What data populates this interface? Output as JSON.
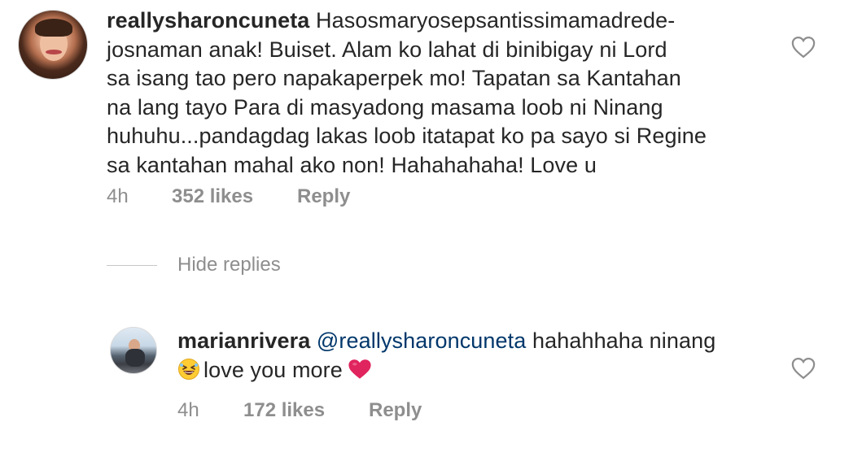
{
  "main_comment": {
    "username": "reallysharoncuneta",
    "text_lines": [
      "Hasosmaryosepsantissimamadrede-",
      "josnaman anak! Buiset. Alam ko lahat di binibigay ni Lord",
      "sa isang tao pero napakaperpek mo! Tapatan sa Kantahan",
      "na lang tayo Para di masyadong masama loob ni Ninang",
      "huhuhu...pandagdag lakas loob itatapat ko pa sayo si Regine",
      "sa kantahan mahal ako non! Hahahahaha! Love u"
    ],
    "time": "4h",
    "likes": "352 likes",
    "reply_label": "Reply",
    "avatar_icon": "profile-avatar",
    "like_icon": "heart-outline-icon"
  },
  "thread": {
    "hide_replies_label": "Hide replies"
  },
  "reply_comment": {
    "username": "marianrivera",
    "mention": "@reallysharoncuneta",
    "text_line1": "hahahhaha ninang",
    "text_line2": "love you more",
    "emoji_before": "grinning-squinting-face-icon",
    "emoji_after": "red-heart-icon",
    "time": "4h",
    "likes": "172 likes",
    "reply_label": "Reply",
    "avatar_icon": "profile-avatar",
    "like_icon": "heart-outline-icon"
  },
  "colors": {
    "text": "#262626",
    "secondary": "#8e8e8e",
    "mention": "#00376b",
    "heart_emoji": "#e0245e"
  }
}
